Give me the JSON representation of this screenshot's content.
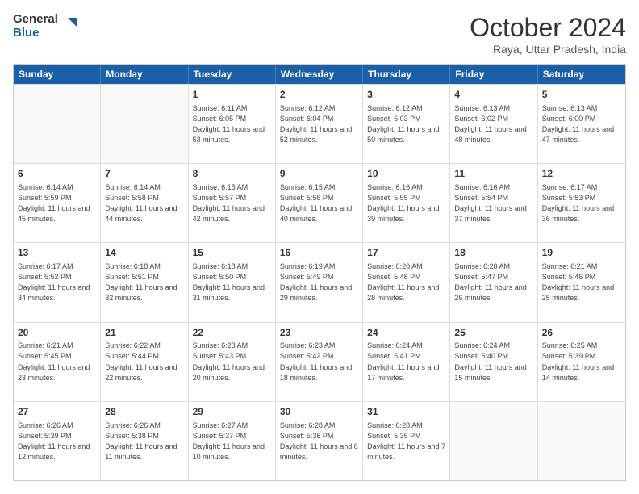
{
  "logo": {
    "line1": "General",
    "line2": "Blue"
  },
  "title": "October 2024",
  "subtitle": "Raya, Uttar Pradesh, India",
  "weekdays": [
    "Sunday",
    "Monday",
    "Tuesday",
    "Wednesday",
    "Thursday",
    "Friday",
    "Saturday"
  ],
  "rows": [
    [
      {
        "day": "",
        "sunrise": "",
        "sunset": "",
        "daylight": ""
      },
      {
        "day": "",
        "sunrise": "",
        "sunset": "",
        "daylight": ""
      },
      {
        "day": "1",
        "sunrise": "Sunrise: 6:11 AM",
        "sunset": "Sunset: 6:05 PM",
        "daylight": "Daylight: 11 hours and 53 minutes."
      },
      {
        "day": "2",
        "sunrise": "Sunrise: 6:12 AM",
        "sunset": "Sunset: 6:04 PM",
        "daylight": "Daylight: 11 hours and 52 minutes."
      },
      {
        "day": "3",
        "sunrise": "Sunrise: 6:12 AM",
        "sunset": "Sunset: 6:03 PM",
        "daylight": "Daylight: 11 hours and 50 minutes."
      },
      {
        "day": "4",
        "sunrise": "Sunrise: 6:13 AM",
        "sunset": "Sunset: 6:02 PM",
        "daylight": "Daylight: 11 hours and 48 minutes."
      },
      {
        "day": "5",
        "sunrise": "Sunrise: 6:13 AM",
        "sunset": "Sunset: 6:00 PM",
        "daylight": "Daylight: 11 hours and 47 minutes."
      }
    ],
    [
      {
        "day": "6",
        "sunrise": "Sunrise: 6:14 AM",
        "sunset": "Sunset: 5:59 PM",
        "daylight": "Daylight: 11 hours and 45 minutes."
      },
      {
        "day": "7",
        "sunrise": "Sunrise: 6:14 AM",
        "sunset": "Sunset: 5:58 PM",
        "daylight": "Daylight: 11 hours and 44 minutes."
      },
      {
        "day": "8",
        "sunrise": "Sunrise: 6:15 AM",
        "sunset": "Sunset: 5:57 PM",
        "daylight": "Daylight: 11 hours and 42 minutes."
      },
      {
        "day": "9",
        "sunrise": "Sunrise: 6:15 AM",
        "sunset": "Sunset: 5:56 PM",
        "daylight": "Daylight: 11 hours and 40 minutes."
      },
      {
        "day": "10",
        "sunrise": "Sunrise: 6:16 AM",
        "sunset": "Sunset: 5:55 PM",
        "daylight": "Daylight: 11 hours and 39 minutes."
      },
      {
        "day": "11",
        "sunrise": "Sunrise: 6:16 AM",
        "sunset": "Sunset: 5:54 PM",
        "daylight": "Daylight: 11 hours and 37 minutes."
      },
      {
        "day": "12",
        "sunrise": "Sunrise: 6:17 AM",
        "sunset": "Sunset: 5:53 PM",
        "daylight": "Daylight: 11 hours and 36 minutes."
      }
    ],
    [
      {
        "day": "13",
        "sunrise": "Sunrise: 6:17 AM",
        "sunset": "Sunset: 5:52 PM",
        "daylight": "Daylight: 11 hours and 34 minutes."
      },
      {
        "day": "14",
        "sunrise": "Sunrise: 6:18 AM",
        "sunset": "Sunset: 5:51 PM",
        "daylight": "Daylight: 11 hours and 32 minutes."
      },
      {
        "day": "15",
        "sunrise": "Sunrise: 6:18 AM",
        "sunset": "Sunset: 5:50 PM",
        "daylight": "Daylight: 11 hours and 31 minutes."
      },
      {
        "day": "16",
        "sunrise": "Sunrise: 6:19 AM",
        "sunset": "Sunset: 5:49 PM",
        "daylight": "Daylight: 11 hours and 29 minutes."
      },
      {
        "day": "17",
        "sunrise": "Sunrise: 6:20 AM",
        "sunset": "Sunset: 5:48 PM",
        "daylight": "Daylight: 11 hours and 28 minutes."
      },
      {
        "day": "18",
        "sunrise": "Sunrise: 6:20 AM",
        "sunset": "Sunset: 5:47 PM",
        "daylight": "Daylight: 11 hours and 26 minutes."
      },
      {
        "day": "19",
        "sunrise": "Sunrise: 6:21 AM",
        "sunset": "Sunset: 5:46 PM",
        "daylight": "Daylight: 11 hours and 25 minutes."
      }
    ],
    [
      {
        "day": "20",
        "sunrise": "Sunrise: 6:21 AM",
        "sunset": "Sunset: 5:45 PM",
        "daylight": "Daylight: 11 hours and 23 minutes."
      },
      {
        "day": "21",
        "sunrise": "Sunrise: 6:22 AM",
        "sunset": "Sunset: 5:44 PM",
        "daylight": "Daylight: 11 hours and 22 minutes."
      },
      {
        "day": "22",
        "sunrise": "Sunrise: 6:23 AM",
        "sunset": "Sunset: 5:43 PM",
        "daylight": "Daylight: 11 hours and 20 minutes."
      },
      {
        "day": "23",
        "sunrise": "Sunrise: 6:23 AM",
        "sunset": "Sunset: 5:42 PM",
        "daylight": "Daylight: 11 hours and 18 minutes."
      },
      {
        "day": "24",
        "sunrise": "Sunrise: 6:24 AM",
        "sunset": "Sunset: 5:41 PM",
        "daylight": "Daylight: 11 hours and 17 minutes."
      },
      {
        "day": "25",
        "sunrise": "Sunrise: 6:24 AM",
        "sunset": "Sunset: 5:40 PM",
        "daylight": "Daylight: 11 hours and 15 minutes."
      },
      {
        "day": "26",
        "sunrise": "Sunrise: 6:25 AM",
        "sunset": "Sunset: 5:39 PM",
        "daylight": "Daylight: 11 hours and 14 minutes."
      }
    ],
    [
      {
        "day": "27",
        "sunrise": "Sunrise: 6:26 AM",
        "sunset": "Sunset: 5:39 PM",
        "daylight": "Daylight: 11 hours and 12 minutes."
      },
      {
        "day": "28",
        "sunrise": "Sunrise: 6:26 AM",
        "sunset": "Sunset: 5:38 PM",
        "daylight": "Daylight: 11 hours and 11 minutes."
      },
      {
        "day": "29",
        "sunrise": "Sunrise: 6:27 AM",
        "sunset": "Sunset: 5:37 PM",
        "daylight": "Daylight: 11 hours and 10 minutes."
      },
      {
        "day": "30",
        "sunrise": "Sunrise: 6:28 AM",
        "sunset": "Sunset: 5:36 PM",
        "daylight": "Daylight: 11 hours and 8 minutes."
      },
      {
        "day": "31",
        "sunrise": "Sunrise: 6:28 AM",
        "sunset": "Sunset: 5:35 PM",
        "daylight": "Daylight: 11 hours and 7 minutes."
      },
      {
        "day": "",
        "sunrise": "",
        "sunset": "",
        "daylight": ""
      },
      {
        "day": "",
        "sunrise": "",
        "sunset": "",
        "daylight": ""
      }
    ]
  ]
}
